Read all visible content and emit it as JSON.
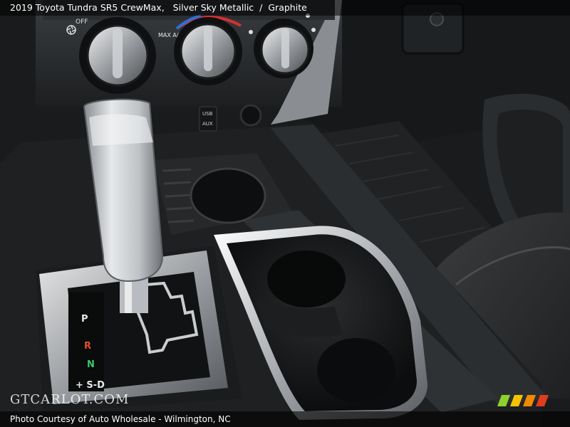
{
  "caption": {
    "vehicle": "2019 Toyota Tundra SR5 CrewMax,",
    "exterior": "Silver Sky Metallic",
    "separator": "/",
    "interior": "Graphite"
  },
  "controls": {
    "fan_off_label": "OFF",
    "max_ac_label": "MAX A/C",
    "usb_label": "USB",
    "aux_label": "AUX"
  },
  "gear_indicator": {
    "gears": [
      "P",
      "R",
      "N",
      "+ S-D"
    ],
    "colors": {
      "P": "#e8e8e8",
      "R": "#e0502e",
      "N": "#3cc86a",
      "S-D": "#e8e8e8"
    }
  },
  "watermark": "GTCARLOT.COM",
  "footer": "Photo Courtesy of Auto Wholesale - Wilmington, NC",
  "logo_colors": [
    "#8fd12a",
    "#f5c400",
    "#f08a00",
    "#e03c1e"
  ]
}
